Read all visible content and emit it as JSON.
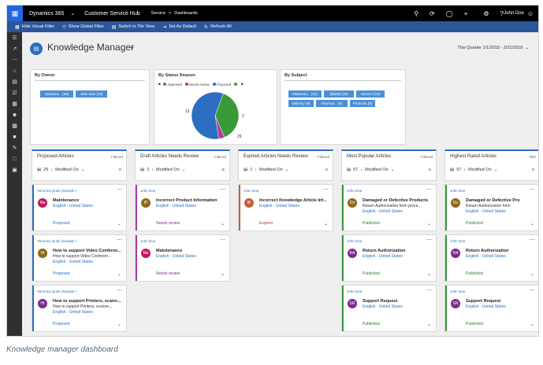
{
  "topbar": {
    "app": "Dynamics 365",
    "hub": "Customer Service Hub",
    "breadcrumb_area": "Service",
    "breadcrumb_sep": ">",
    "breadcrumb_page": "Dashboards",
    "user": "John Doe"
  },
  "commands": [
    {
      "label": "Hide Visual Filter",
      "icon": "chart-icon"
    },
    {
      "label": "Show Global Filter",
      "icon": "filter-icon"
    },
    {
      "label": "Switch to Tile View",
      "icon": "tile-icon"
    },
    {
      "label": "Set As Default",
      "icon": "pin-icon"
    },
    {
      "label": "Refresh All",
      "icon": "refresh-icon"
    }
  ],
  "dashboard": {
    "title": "Knowledge Manager",
    "period": "This Quarter 1/1/2018 - 3/31/2018"
  },
  "charts": {
    "owner": {
      "title": "By Owner",
      "tags": [
        "Veronica... (46)",
        "John Doe (10)"
      ]
    },
    "status": {
      "title": "By Status Reason",
      "legend": [
        "Approved",
        "Needs review",
        "Proposed"
      ],
      "labels": [
        "19",
        "2",
        "29"
      ]
    },
    "subject": {
      "title": "By Subject",
      "tags_row1": [
        "Maintena... (14)",
        "(blank) (10)",
        "Service (10)"
      ],
      "tags_row2": [
        "Delivery (9)",
        "Informat... (8)",
        "Products (5)"
      ]
    }
  },
  "chart_data": {
    "type": "pie",
    "title": "By Status Reason",
    "categories": [
      "Approved",
      "Needs review",
      "Proposed"
    ],
    "values": [
      19,
      2,
      29
    ],
    "colors": [
      "#3a9a3a",
      "#b03aa0",
      "#2b6ec2"
    ]
  },
  "columns": [
    {
      "title": "Proposed Articles",
      "filter": "Filtered",
      "count": "29",
      "sort": "Modified On",
      "cards": [
        {
          "owner": "Veronica Quek (Sample I",
          "initials": "Ma",
          "avatar": "#c2185b",
          "name": "Maintenance",
          "sub": "",
          "lang": "English - United States",
          "status": "Proposed",
          "status_color": "#2b6ec2",
          "bar": "#2b6ec2"
        },
        {
          "owner": "Veronica Quek (Sample I",
          "initials": "Ht",
          "avatar": "#8a6a1a",
          "name": "How to support Video Conferen...",
          "sub": "How to support Video Conferen...",
          "lang": "English - United States",
          "status": "Proposed",
          "status_color": "#2b6ec2",
          "bar": "#2b6ec2"
        },
        {
          "owner": "Veronica Quek (Sample I",
          "initials": "Ht",
          "avatar": "#7b2d8a",
          "name": "How to support Printers, scann...",
          "sub": "How to support Printers, scanne...",
          "lang": "English - United States",
          "status": "Proposed",
          "status_color": "#2b6ec2",
          "bar": "#2b6ec2"
        }
      ]
    },
    {
      "title": "Draft Articles Needs Review",
      "filter": "Filtered",
      "count": "2",
      "sort": "Modified On",
      "cards": [
        {
          "owner": "John Doe",
          "initials": "IP",
          "avatar": "#8a6a1a",
          "name": "Incorrect Product Information",
          "sub": "",
          "lang": "English - United States",
          "status": "Needs review",
          "status_color": "#8a2d8a",
          "bar": "#a040a0"
        },
        {
          "owner": "John Doe",
          "initials": "Ma",
          "avatar": "#c2185b",
          "name": "Maintenance",
          "sub": "",
          "lang": "English - United States",
          "status": "Needs review",
          "status_color": "#8a2d8a",
          "bar": "#a040a0"
        }
      ]
    },
    {
      "title": "Expired Articles Needs Review",
      "filter": "Filtered",
      "count": "1",
      "sort": "Modified On",
      "cards": [
        {
          "owner": "John Doe",
          "initials": "IK",
          "avatar": "#c0603a",
          "name": "Incorrect Knowledge Article Inf...",
          "sub": "",
          "lang": "English - United States",
          "status": "Expired",
          "status_color": "#c0392b",
          "bar": "#c0603a"
        }
      ]
    },
    {
      "title": "Most Popular Articles",
      "filter": "Filtered",
      "count": "57",
      "sort": "Modified On",
      "cards": [
        {
          "owner": "John Doe",
          "initials": "Do",
          "avatar": "#8a6a1a",
          "name": "Damaged or Defective Products",
          "sub": "Return Authorization form proce...",
          "lang": "English - United States",
          "status": "Published",
          "status_color": "#2e7d32",
          "bar": "#3a9a3a"
        },
        {
          "owner": "John Doe",
          "initials": "RA",
          "avatar": "#7b2d8a",
          "name": "Return Authorization",
          "sub": "",
          "lang": "English - United States",
          "status": "Published",
          "status_color": "#2e7d32",
          "bar": "#3a9a3a"
        },
        {
          "owner": "John Doe",
          "initials": "SR",
          "avatar": "#7b2d8a",
          "name": "Support Request",
          "sub": "",
          "lang": "English - United States",
          "status": "Published",
          "status_color": "#2e7d32",
          "bar": "#3a9a3a"
        }
      ]
    },
    {
      "title": "Highest Rated Articles",
      "filter": "Filte",
      "count": "57",
      "sort": "Modified On",
      "cards": [
        {
          "owner": "John Doe",
          "initials": "Du",
          "avatar": "#8a6a1a",
          "name": "Damaged or Defective Pro",
          "sub": "Return Authorization form",
          "lang": "English - United States",
          "status": "Published",
          "status_color": "#2e7d32",
          "bar": "#3a9a3a"
        },
        {
          "owner": "John Doe",
          "initials": "RA",
          "avatar": "#7b2d8a",
          "name": "Return Authorization",
          "sub": "",
          "lang": "English - United States",
          "status": "Published",
          "status_color": "#2e7d32",
          "bar": "#3a9a3a"
        },
        {
          "owner": "John Doe",
          "initials": "SR",
          "avatar": "#7b2d8a",
          "name": "Support Request",
          "sub": "",
          "lang": "English - United States",
          "status": "Published",
          "status_color": "#2e7d32",
          "bar": "#3a9a3a"
        }
      ]
    }
  ],
  "caption": "Knowledge manager dashboard"
}
